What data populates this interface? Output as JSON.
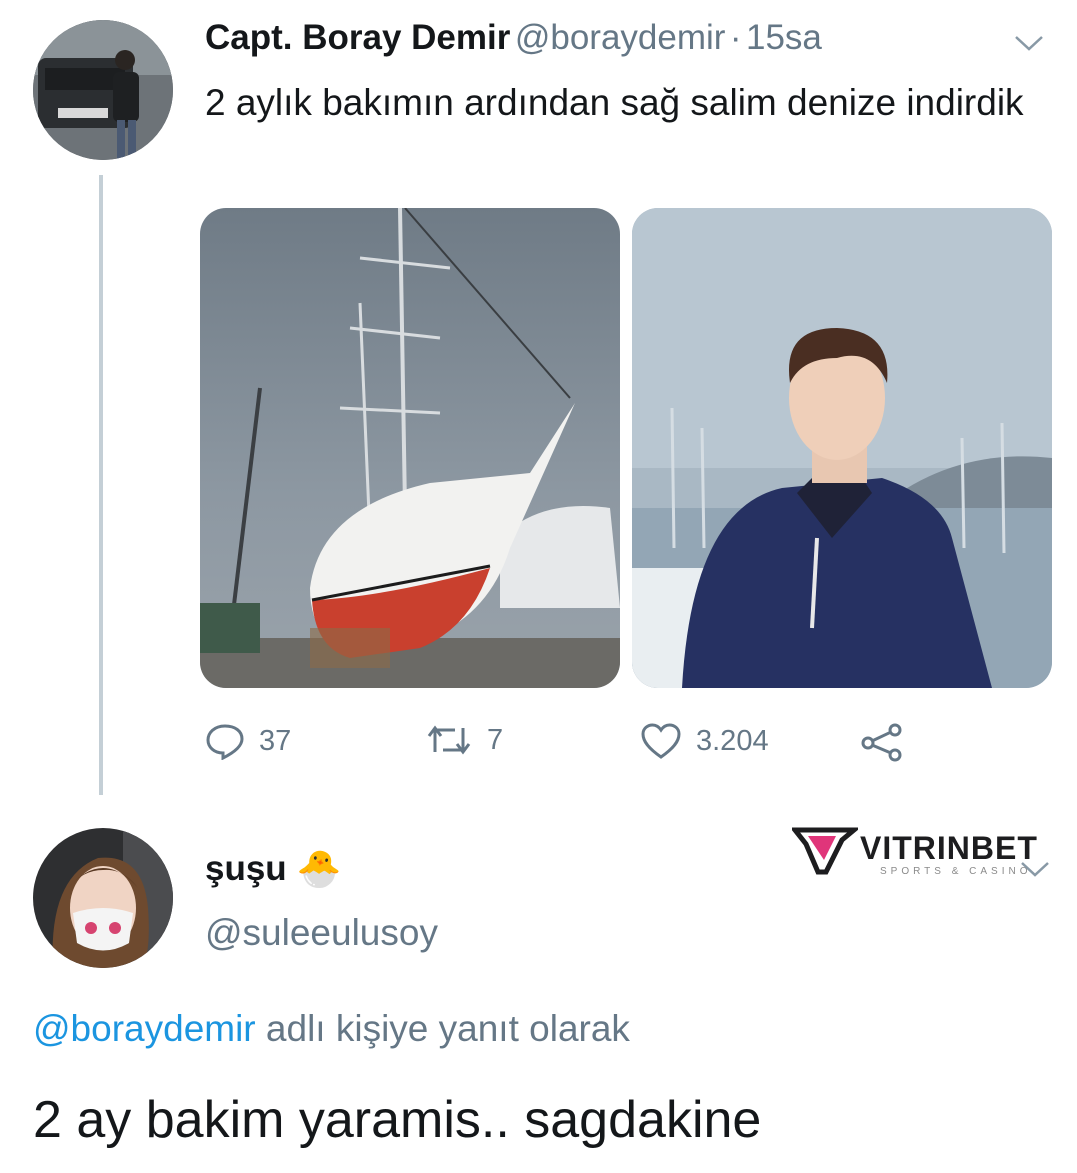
{
  "tweet": {
    "author_name": "Capt. Boray Demir",
    "author_handle": "@boraydemir",
    "separator": "·",
    "time": "15sa",
    "text": "2 aylık bakımın ardından sağ salim denize indirdik",
    "actions": {
      "reply_count": "37",
      "retweet_count": "7",
      "like_count": "3.204"
    }
  },
  "reply": {
    "author_name": "şuşu",
    "author_emoji": "🐣",
    "author_handle": "@suleeulusoy",
    "reply_to_mention": "@boraydemir",
    "reply_to_suffix": "adlı kişiye yanıt olarak",
    "text": "2 ay bakim yaramis.. sagdakine"
  },
  "watermark": {
    "brand": "VITRINBET",
    "tagline": "SPORTS & CASINO"
  },
  "colors": {
    "link": "#1b95e0",
    "secondary_text": "#657786",
    "thread_line": "#c4cfd6",
    "watermark_accent": "#e0357a"
  }
}
